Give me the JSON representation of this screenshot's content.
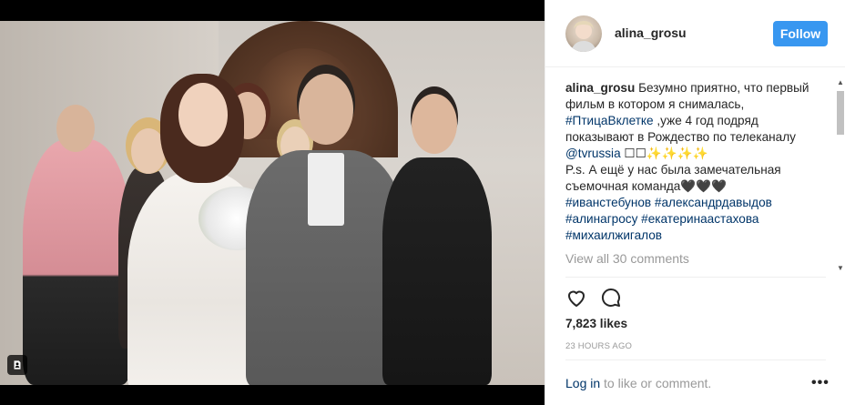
{
  "post": {
    "username": "alina_grosu",
    "follow_label": "Follow",
    "caption": {
      "username": "alina_grosu",
      "text1": "Безумно приятно, что первый фильм в котором я снималась,",
      "hashtag1": "#ПтицаВклетке",
      "text2": " ,уже 4 год подряд показывают в Рождество по телеканалу",
      "mention": "@tvrussia",
      "text3": " ☐☐✨✨✨✨",
      "text4": "P.s. А ещё у нас была замечательная съемочная команда🖤🖤🖤",
      "tags": [
        "#иванстебунов",
        "#александрдавыдов",
        "#алинагросу",
        "#екатеринаастахова",
        "#михаилжигалов"
      ]
    },
    "view_all_label": "View all 30 comments",
    "likes_label": "7,823 likes",
    "time_label": "23 HOURS AGO",
    "login_link": "Log in",
    "login_text": " to like or comment.",
    "more_label": "•••"
  },
  "icons": {
    "like": "heart-icon",
    "comment": "comment-icon",
    "media_type": "video-camera-icon",
    "more": "more-options-icon"
  },
  "colors": {
    "follow_button": "#3897f0",
    "link": "#003569",
    "muted": "#999999"
  }
}
